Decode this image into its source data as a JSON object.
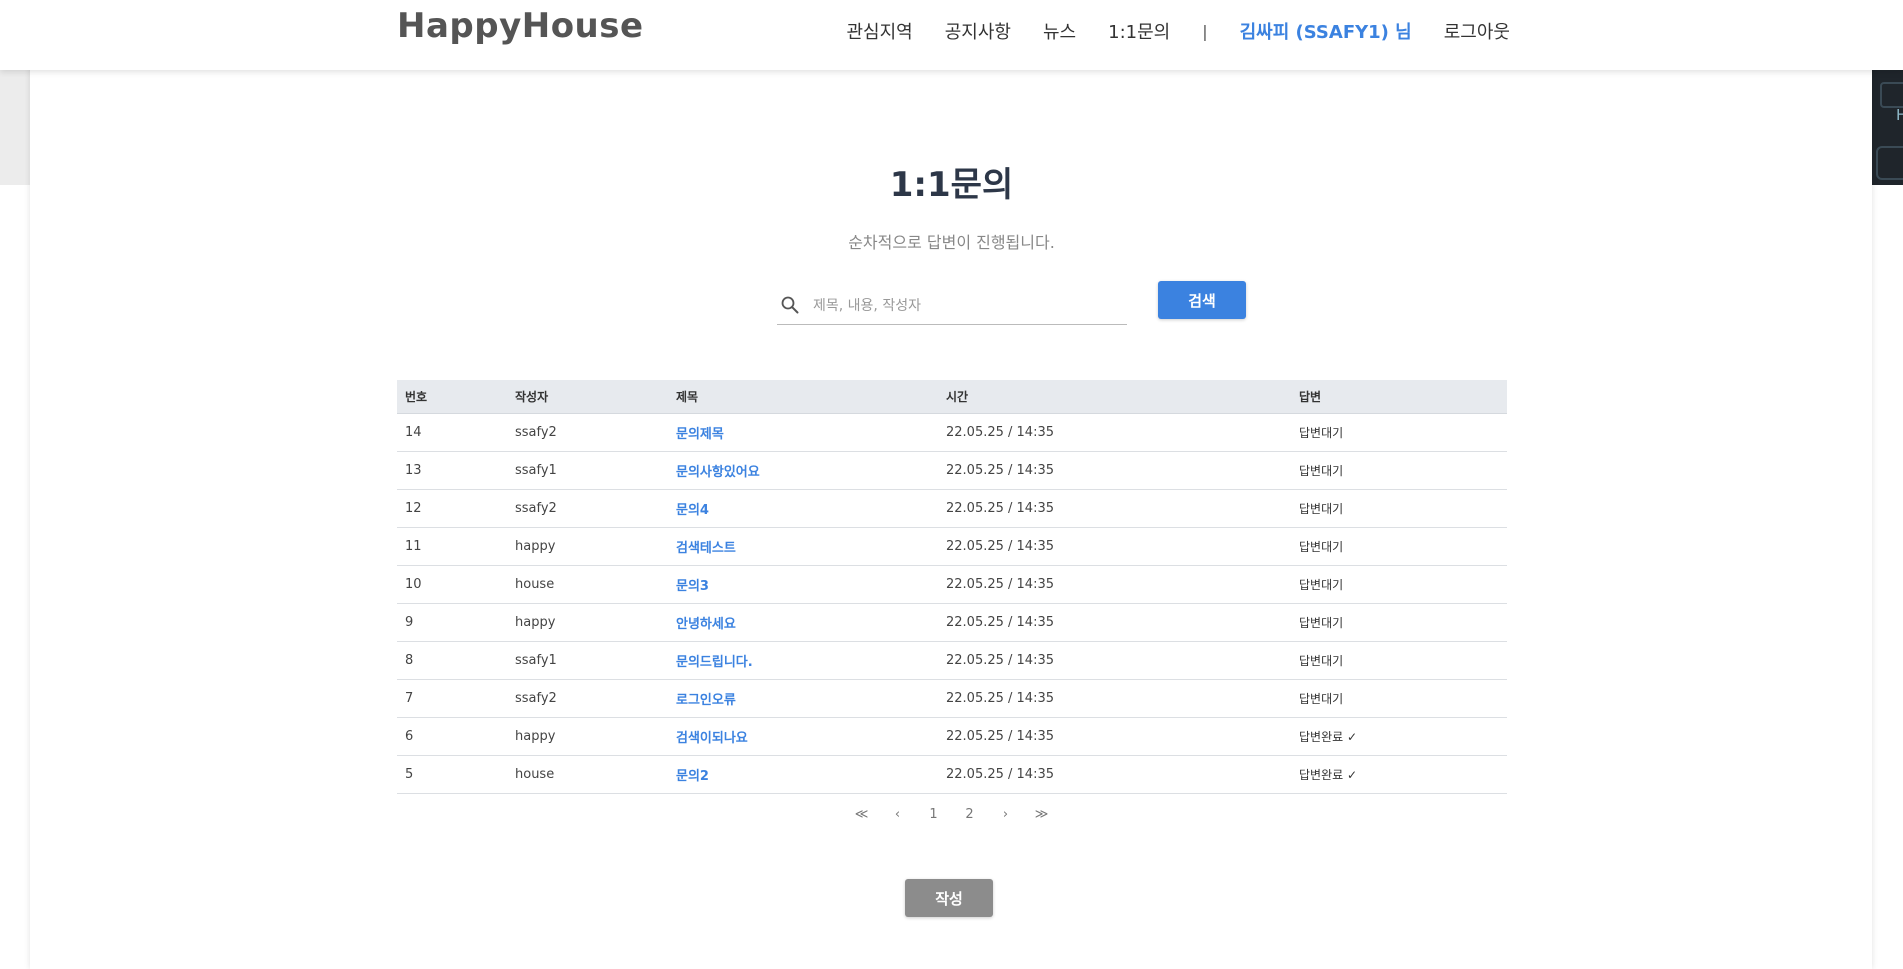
{
  "navbar": {
    "brand": "HappyHouse",
    "items": [
      {
        "label": "관심지역"
      },
      {
        "label": "공지사항"
      },
      {
        "label": "뉴스"
      },
      {
        "label": "1:1문의"
      }
    ],
    "separator": "|",
    "user": "김싸피 (SSAFY1) 님",
    "logout": "로그아웃"
  },
  "page": {
    "title": "1:1문의",
    "subtitle": "순차적으로 답변이 진행됩니다."
  },
  "search": {
    "placeholder": "제목, 내용, 작성자",
    "value": "",
    "button_label": "검색"
  },
  "table": {
    "headers": [
      "번호",
      "작성자",
      "제목",
      "시간",
      "답변"
    ],
    "rows": [
      {
        "no": "14",
        "author": "ssafy2",
        "title": "문의제목",
        "time": "22.05.25 / 14:35",
        "answer": "답변대기"
      },
      {
        "no": "13",
        "author": "ssafy1",
        "title": "문의사항있어요",
        "time": "22.05.25 / 14:35",
        "answer": "답변대기"
      },
      {
        "no": "12",
        "author": "ssafy2",
        "title": "문의4",
        "time": "22.05.25 / 14:35",
        "answer": "답변대기"
      },
      {
        "no": "11",
        "author": "happy",
        "title": "검색테스트",
        "time": "22.05.25 / 14:35",
        "answer": "답변대기"
      },
      {
        "no": "10",
        "author": "house",
        "title": "문의3",
        "time": "22.05.25 / 14:35",
        "answer": "답변대기"
      },
      {
        "no": "9",
        "author": "happy",
        "title": "안녕하세요",
        "time": "22.05.25 / 14:35",
        "answer": "답변대기"
      },
      {
        "no": "8",
        "author": "ssafy1",
        "title": "문의드립니다.",
        "time": "22.05.25 / 14:35",
        "answer": "답변대기"
      },
      {
        "no": "7",
        "author": "ssafy2",
        "title": "로그인오류",
        "time": "22.05.25 / 14:35",
        "answer": "답변대기"
      },
      {
        "no": "6",
        "author": "happy",
        "title": "검색이되나요",
        "time": "22.05.25 / 14:35",
        "answer": "답변완료 ✓"
      },
      {
        "no": "5",
        "author": "house",
        "title": "문의2",
        "time": "22.05.25 / 14:35",
        "answer": "답변완료 ✓"
      }
    ]
  },
  "pagination": {
    "first": "≪",
    "prev": "‹",
    "pages": [
      "1",
      "2"
    ],
    "next": "›",
    "last": "≫"
  },
  "write_button": "작성",
  "colors": {
    "accent": "#3b82e0",
    "write_button": "#8c8c8c",
    "table_header_bg": "#e7eaee"
  },
  "icons": {
    "search": "search-icon"
  }
}
